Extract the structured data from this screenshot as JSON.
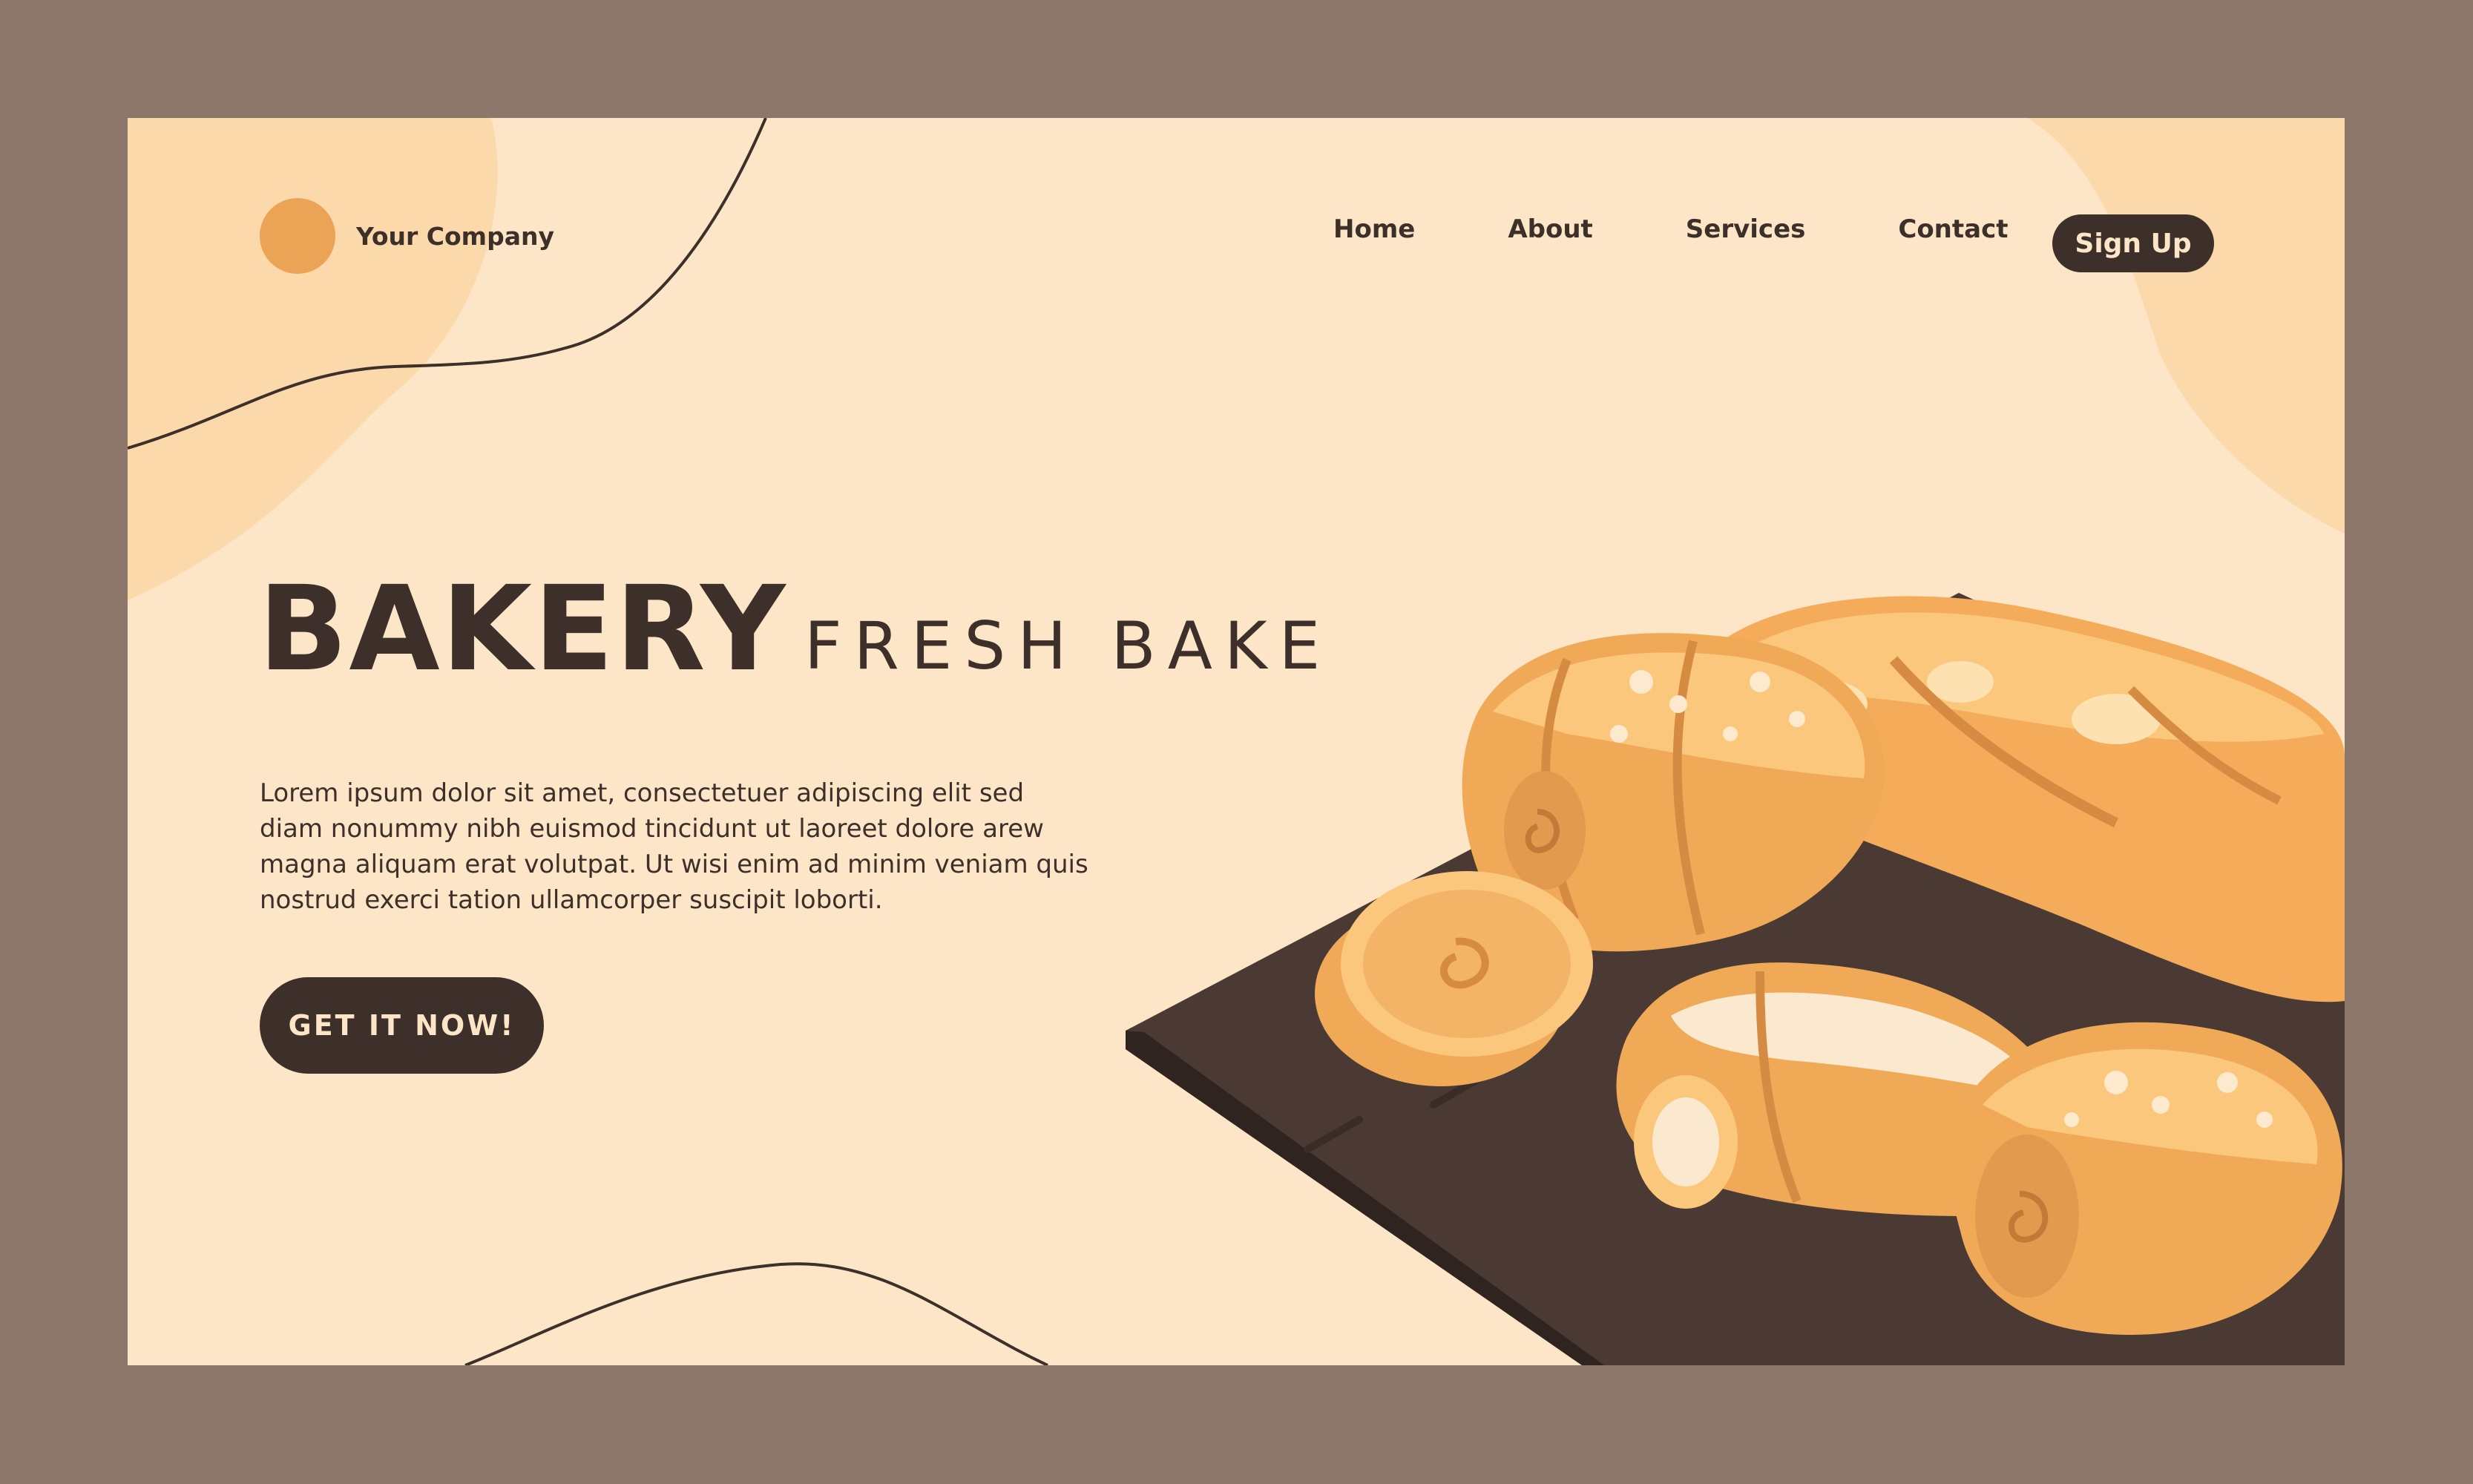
{
  "brand": {
    "name": "Your Company"
  },
  "nav": {
    "items": [
      "Home",
      "About",
      "Services",
      "Contact"
    ],
    "signup_label": "Sign Up"
  },
  "hero": {
    "title": "BAKERY",
    "subtitle": "FRESH BAKE",
    "body": "Lorem ipsum dolor sit amet, consectetuer adipiscing elit  sed diam nonummy nibh euismod tincidunt ut laoreet dolore arew magna aliquam erat volutpat. Ut wisi enim ad minim veniam quis nostrud exerci tation ullamcorper suscipit loborti.",
    "cta_label": "GET IT NOW!"
  },
  "colors": {
    "outer_bg": "#8d766a",
    "page_bg": "#fce6c7",
    "accent": "#eba455",
    "dark": "#3d2f29",
    "board": "#4a3a33",
    "bread_light": "#fbc77d",
    "bread_mid": "#f0a957",
    "bread_dark": "#d68b43",
    "icing": "#fbe9cf"
  },
  "icons": {
    "logo": "orange-circle-logo",
    "illustration": "bread-board-illustration"
  }
}
